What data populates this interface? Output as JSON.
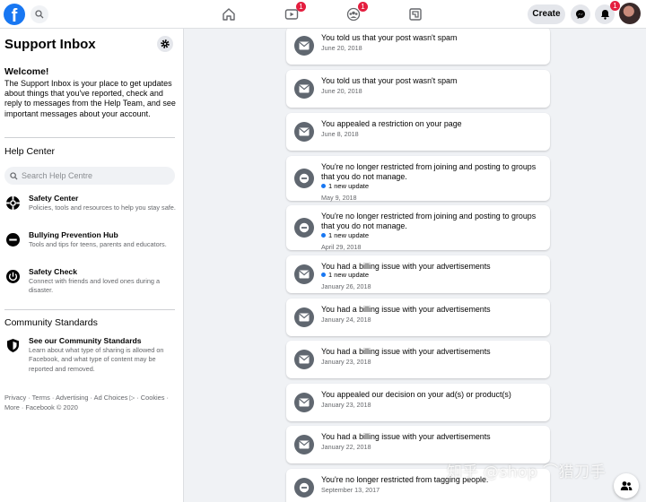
{
  "topbar": {
    "logo_letter": "f",
    "notifications": {
      "watch_badge": "1",
      "groups_badge": "1",
      "bell_badge": "1"
    },
    "create_label": "Create"
  },
  "sidebar": {
    "title": "Support Inbox",
    "welcome_heading": "Welcome!",
    "welcome_text": "The Support Inbox is your place to get updates about things that you've reported, check and reply to messages from the Help Team, and see important messages about your account.",
    "help_center_heading": "Help Center",
    "search_placeholder": "Search Help Centre",
    "help_items": [
      {
        "icon": "safety-center-icon",
        "title": "Safety Center",
        "desc": "Policies, tools and resources to help you stay safe."
      },
      {
        "icon": "minus-circle-icon",
        "title": "Bullying Prevention Hub",
        "desc": "Tools and tips for teens, parents and educators."
      },
      {
        "icon": "power-icon",
        "title": "Safety Check",
        "desc": "Connect with friends and loved ones during a disaster."
      }
    ],
    "community_heading": "Community Standards",
    "community_item": {
      "icon": "shield-icon",
      "title": "See our Community Standards",
      "desc": "Learn about what type of sharing is allowed on Facebook, and what type of content may be reported and removed."
    },
    "footer_text": "Privacy · Terms · Advertising · Ad Choices ▷ · Cookies · More · Facebook © 2020"
  },
  "inbox": {
    "items": [
      {
        "icon": "envelope-icon",
        "title": "You told us that your post wasn't spam",
        "update": "",
        "date": "June 20, 2018"
      },
      {
        "icon": "envelope-icon",
        "title": "You told us that your post wasn't spam",
        "update": "",
        "date": "June 20, 2018"
      },
      {
        "icon": "envelope-icon",
        "title": "You appealed a restriction on your page",
        "update": "",
        "date": "June 8, 2018"
      },
      {
        "icon": "minus-circle-icon",
        "title": "You're no longer restricted from joining and posting to groups that you do not manage.",
        "update": "1 new update",
        "date": "May 9, 2018"
      },
      {
        "icon": "minus-circle-icon",
        "title": "You're no longer restricted from joining and posting to groups that you do not manage.",
        "update": "1 new update",
        "date": "April 29, 2018"
      },
      {
        "icon": "envelope-icon",
        "title": "You had a billing issue with your advertisements",
        "update": "1 new update",
        "date": "January 26, 2018"
      },
      {
        "icon": "envelope-icon",
        "title": "You had a billing issue with your advertisements",
        "update": "",
        "date": "January 24, 2018"
      },
      {
        "icon": "envelope-icon",
        "title": "You had a billing issue with your advertisements",
        "update": "",
        "date": "January 23, 2018"
      },
      {
        "icon": "envelope-icon",
        "title": "You appealed our decision on your ad(s) or product(s)",
        "update": "",
        "date": "January 23, 2018"
      },
      {
        "icon": "envelope-icon",
        "title": "You had a billing issue with your advertisements",
        "update": "",
        "date": "January 22, 2018"
      },
      {
        "icon": "minus-circle-icon",
        "title": "You're no longer restricted from tagging people.",
        "update": "",
        "date": "September 13, 2017"
      }
    ]
  },
  "watermark": "知乎 @shop ⌒猎刀手",
  "colors": {
    "brand": "#1877f2",
    "badge": "#e41e3f",
    "icon_gray": "#606770",
    "page_bg": "#f0f2f5"
  }
}
